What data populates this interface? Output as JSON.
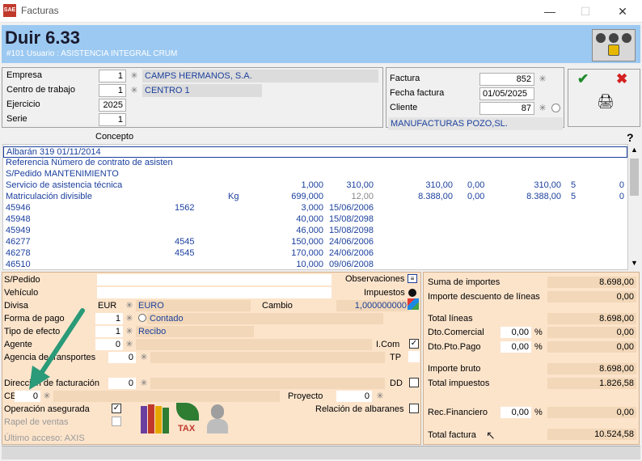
{
  "window": {
    "title": "Facturas",
    "app_icon": "SAE"
  },
  "header": {
    "title": "Duir 6.33",
    "subtitle": "#101 Usuario : ASISTENCIA INTEGRAL CRUM"
  },
  "company": {
    "empresa_label": "Empresa",
    "empresa_value": "1",
    "empresa_name": "CAMPS HERMANOS, S.A.",
    "centro_label": "Centro de trabajo",
    "centro_value": "1",
    "centro_name": "CENTRO 1",
    "ejercicio_label": "Ejercicio",
    "ejercicio_value": "2025",
    "serie_label": "Serie",
    "serie_value": "1"
  },
  "invoice": {
    "factura_label": "Factura",
    "factura_value": "852",
    "fecha_label": "Fecha factura",
    "fecha_value": "01/05/2025",
    "cliente_label": "Cliente",
    "cliente_value": "87",
    "cliente_name": "MANUFACTURAS POZO,SL."
  },
  "grid": {
    "column_concepto": "Concepto",
    "help": "?",
    "rows": [
      {
        "c": "Albarán 319 01/11/2014",
        "a": "",
        "u": "",
        "q": "",
        "p": "",
        "t": "",
        "d": "",
        "n": "",
        "i": "",
        "z": ""
      },
      {
        "c": "Referencia Número de contrato de asisten",
        "a": "",
        "u": "",
        "q": "",
        "p": "",
        "t": "",
        "d": "",
        "n": "",
        "i": "",
        "z": ""
      },
      {
        "c": "S/Pedido MANTENIMIENTO",
        "a": "",
        "u": "",
        "q": "",
        "p": "",
        "t": "",
        "d": "",
        "n": "",
        "i": "",
        "z": ""
      },
      {
        "c": "Servicio de asistencia técnica",
        "a": "",
        "u": "",
        "q": "1,000",
        "p": "310,00",
        "t": "310,00",
        "d": "0,00",
        "n": "310,00",
        "i": "5",
        "z": "0"
      },
      {
        "c": "Matriculación divisible",
        "a": "",
        "u": "Kg",
        "q": "699,000",
        "p": "12,00",
        "t": "8.388,00",
        "d": "0,00",
        "n": "8.388,00",
        "i": "5",
        "z": "0"
      },
      {
        "c": "45946",
        "a": "1562",
        "u": "",
        "q": "3,000",
        "p": "15/06/2006",
        "t": "",
        "d": "",
        "n": "",
        "i": "",
        "z": ""
      },
      {
        "c": "45948",
        "a": "",
        "u": "",
        "q": "40,000",
        "p": "15/08/2098",
        "t": "",
        "d": "",
        "n": "",
        "i": "",
        "z": ""
      },
      {
        "c": "45949",
        "a": "",
        "u": "",
        "q": "46,000",
        "p": "15/08/2098",
        "t": "",
        "d": "",
        "n": "",
        "i": "",
        "z": ""
      },
      {
        "c": "46277",
        "a": "4545",
        "u": "",
        "q": "150,000",
        "p": "24/06/2006",
        "t": "",
        "d": "",
        "n": "",
        "i": "",
        "z": ""
      },
      {
        "c": "46278",
        "a": "4545",
        "u": "",
        "q": "170,000",
        "p": "24/06/2006",
        "t": "",
        "d": "",
        "n": "",
        "i": "",
        "z": ""
      },
      {
        "c": "46510",
        "a": "",
        "u": "",
        "q": "10,000",
        "p": "09/06/2008",
        "t": "",
        "d": "",
        "n": "",
        "i": "",
        "z": ""
      }
    ]
  },
  "form": {
    "spedido_label": "S/Pedido",
    "observaciones_label": "Observaciones",
    "vehiculo_label": "Vehículo",
    "impuestos_label": "Impuestos",
    "divisa_label": "Divisa",
    "divisa_code": "EUR",
    "divisa_name": "EURO",
    "cambio_label": "Cambio",
    "cambio_value": "1,000000000",
    "forma_pago_label": "Forma de pago",
    "forma_pago_value": "1",
    "forma_pago_name": "Contado",
    "tipo_efecto_label": "Tipo de efecto",
    "tipo_efecto_value": "1",
    "tipo_efecto_name": "Recibo",
    "agente_label": "Agente",
    "agente_value": "0",
    "icom_label": "I.Com",
    "agencia_label": "Agencia de transportes",
    "agencia_value": "0",
    "tp_label": "TP",
    "direccion_label": "Dirección de facturación",
    "direccion_value": "0",
    "dd_label": "DD",
    "ce_label": "CE",
    "ce_value": "0",
    "proyecto_label": "Proyecto",
    "proyecto_value": "0",
    "operacion_label": "Operación asegurada",
    "relacion_label": "Relación de albaranes",
    "rapel_label": "Rapel de ventas",
    "tax_label": "TAX",
    "ultimo_acceso": "Último acceso: AXIS"
  },
  "totals": {
    "suma_label": "Suma de importes",
    "suma_value": "8.698,00",
    "desc_label": "Importe descuento de líneas",
    "desc_value": "0,00",
    "total_lineas_label": "Total líneas",
    "total_lineas_value": "8.698,00",
    "dto_com_label": "Dto.Comercial",
    "dto_com_pct": "0,00",
    "dto_com_value": "0,00",
    "dto_pp_label": "Dto.Pto.Pago",
    "dto_pp_pct": "0,00",
    "dto_pp_value": "0,00",
    "bruto_label": "Importe bruto",
    "bruto_value": "8.698,00",
    "impuestos_label": "Total impuestos",
    "impuestos_value": "1.826,58",
    "rec_label": "Rec.Financiero",
    "rec_pct": "0,00",
    "rec_value": "0,00",
    "total_label": "Total factura",
    "total_value": "10.524,58",
    "pct": "%"
  },
  "colors": {
    "header": "#9cc9f1",
    "panel": "#fce4cb",
    "link": "#1a3f9c",
    "ok": "#1f8a2a",
    "cancel": "#d42020"
  }
}
